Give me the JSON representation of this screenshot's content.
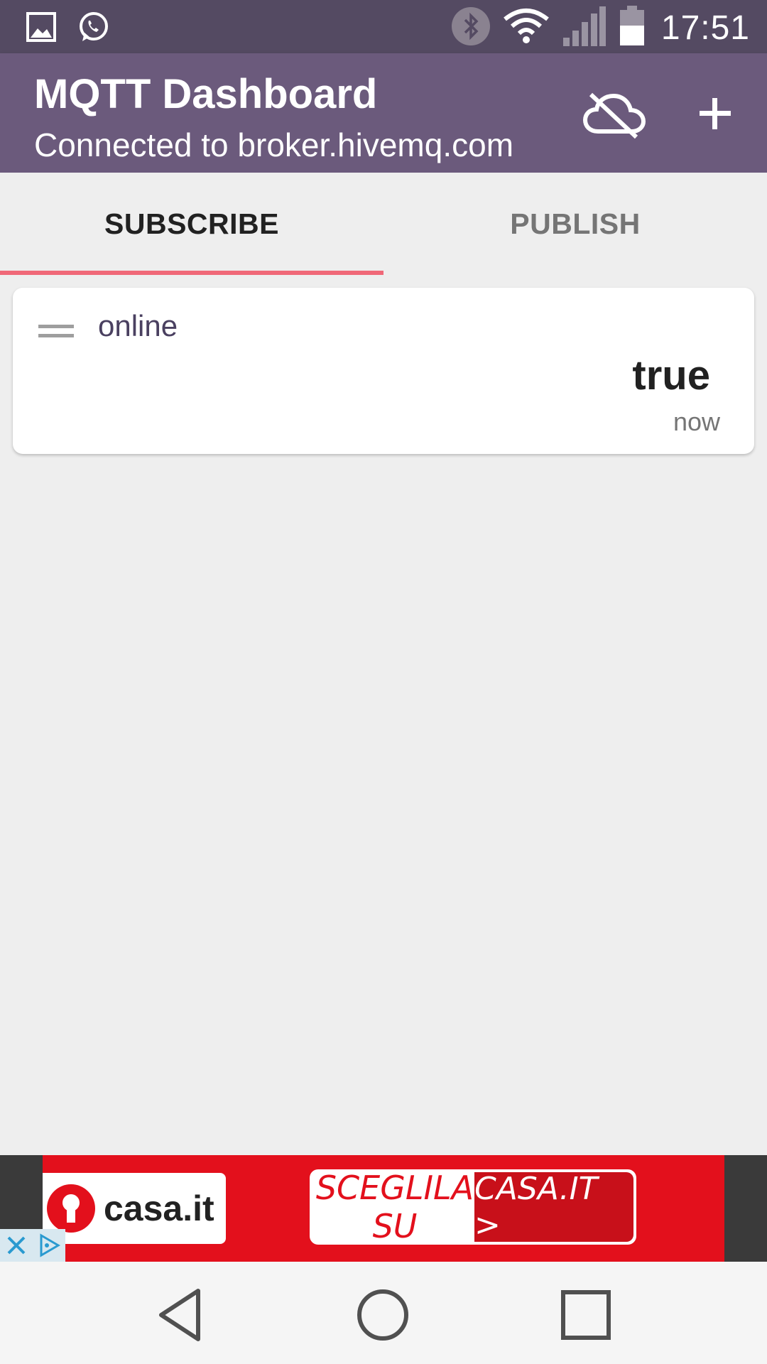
{
  "status_bar": {
    "time": "17:51",
    "left_icons": [
      "gallery-icon",
      "whatsapp-icon"
    ],
    "right_icons": [
      "bluetooth-icon",
      "wifi-icon",
      "signal-icon",
      "battery-icon"
    ]
  },
  "app_bar": {
    "title": "MQTT Dashboard",
    "subtitle": "Connected to broker.hivemq.com",
    "actions": [
      "cloud-off-icon",
      "add-icon"
    ],
    "background": "#6b5a7c"
  },
  "tabs": [
    {
      "label": "SUBSCRIBE",
      "selected": true
    },
    {
      "label": "PUBLISH",
      "selected": false
    }
  ],
  "tab_indicator_color": "#f06878",
  "cards": [
    {
      "topic": "online",
      "value": "true",
      "time": "now"
    }
  ],
  "ad": {
    "brand": "casa.it",
    "cta_left": "SCEGLILA SU",
    "cta_right": "CASA.IT >",
    "color": "#e3101c"
  },
  "nav_bar": {
    "buttons": [
      "back-icon",
      "home-icon",
      "recent-apps-icon"
    ]
  }
}
